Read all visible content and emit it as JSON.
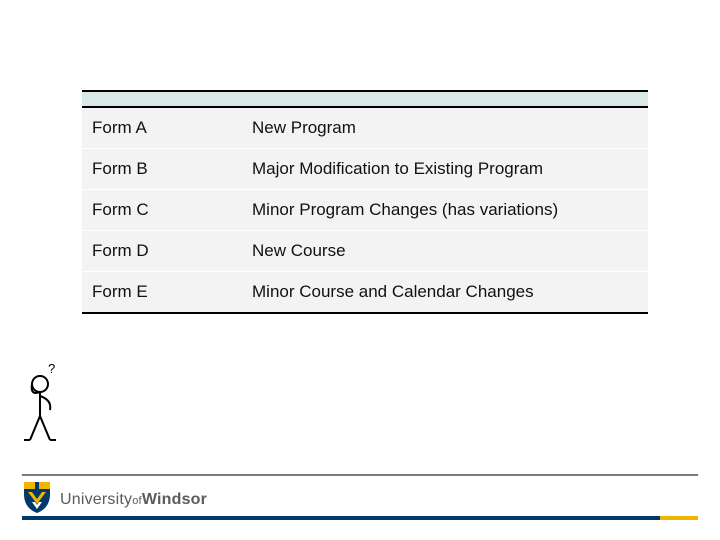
{
  "table": {
    "rows": [
      {
        "form": "Form A",
        "desc": "New Program"
      },
      {
        "form": "Form B",
        "desc": "Major Modification to Existing Program"
      },
      {
        "form": "Form C",
        "desc": "Minor Program Changes (has variations)"
      },
      {
        "form": "Form D",
        "desc": "New Course"
      },
      {
        "form": "Form E",
        "desc": "Minor Course and Calendar Changes"
      }
    ]
  },
  "footer": {
    "university_prefix": "University",
    "of": "of",
    "university_name": "Windsor"
  },
  "icons": {
    "thinker": "thinking-person-icon",
    "shield": "university-shield-icon"
  }
}
